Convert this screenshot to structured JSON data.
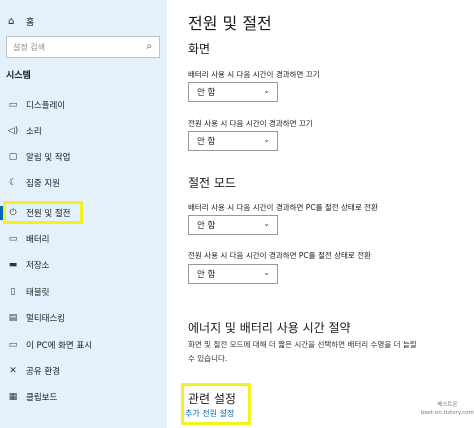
{
  "sidebar": {
    "home_label": "홈",
    "search_placeholder": "설정 검색",
    "section_title": "시스템",
    "items": [
      {
        "label": "디스플레이",
        "icon": "display-icon"
      },
      {
        "label": "소리",
        "icon": "sound-icon"
      },
      {
        "label": "알림 및 작업",
        "icon": "notifications-icon"
      },
      {
        "label": "집중 지원",
        "icon": "focus-assist-icon"
      },
      {
        "label": "전원 및 절전",
        "icon": "power-icon"
      },
      {
        "label": "배터리",
        "icon": "battery-icon"
      },
      {
        "label": "저장소",
        "icon": "storage-icon"
      },
      {
        "label": "태블릿",
        "icon": "tablet-icon"
      },
      {
        "label": "멀티태스킹",
        "icon": "multitasking-icon"
      },
      {
        "label": "이 PC에 화면 표시",
        "icon": "project-icon"
      },
      {
        "label": "공유 환경",
        "icon": "shared-experiences-icon"
      },
      {
        "label": "클립보드",
        "icon": "clipboard-icon"
      }
    ],
    "selected_index": 4
  },
  "main": {
    "title": "전원 및 절전",
    "screen": {
      "heading": "화면",
      "battery_label": "배터리 사용 시 다음 시간이 경과하면 끄기",
      "battery_value": "안 함",
      "plugged_label": "전원 사용 시 다음 시간이 경과하면 끄기",
      "plugged_value": "안 함"
    },
    "sleep": {
      "heading": "절전 모드",
      "battery_label": "배터리 사용 시 다음 시간이 경과하면 PC를 절전 상태로 전환",
      "battery_value": "안 함",
      "plugged_label": "전원 사용 시 다음 시간이 경과하면 PC를 절전 상태로 전환",
      "plugged_value": "안 함"
    },
    "energy": {
      "heading": "에너지 및 배터리 사용 시간 절약",
      "desc_line1": "화면 및 절전 모드에 대해 더 짧은 시간을 선택하면 배터리 수명을 더 늘릴",
      "desc_line2": "수 있습니다."
    },
    "related": {
      "heading": "관련 설정",
      "link": "추가 전원 설정"
    }
  },
  "watermark": {
    "line1": "베스트온",
    "line2": "best-on.tistory.com"
  },
  "colors": {
    "sidebar_bg": "#e4f1fb",
    "highlight": "#f3f21c",
    "link": "#0067c0"
  }
}
